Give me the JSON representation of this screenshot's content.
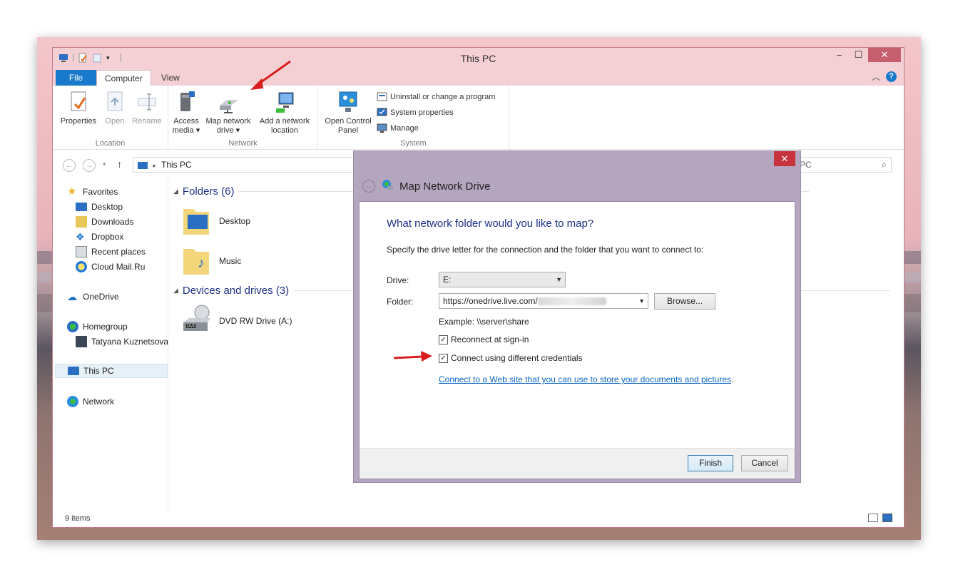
{
  "window": {
    "title": "This PC",
    "tabs": {
      "file": "File",
      "computer": "Computer",
      "view": "View"
    },
    "minimize": "−",
    "maximize": "☐",
    "close": "✕",
    "help": "?"
  },
  "ribbon": {
    "location": {
      "label": "Location",
      "properties": "Properties",
      "open": "Open",
      "rename": "Rename"
    },
    "network": {
      "label": "Network",
      "access_media": [
        "Access",
        "media ▾"
      ],
      "map_drive": [
        "Map network",
        "drive ▾"
      ],
      "add_location": [
        "Add a network",
        "location"
      ]
    },
    "system": {
      "label": "System",
      "open_cp": [
        "Open Control",
        "Panel"
      ],
      "uninstall": "Uninstall or change a program",
      "sysprops": "System properties",
      "manage": "Manage"
    }
  },
  "address": {
    "path": "This PC",
    "search_tail": "PC"
  },
  "nav": {
    "favorites": "Favorites",
    "desktop": "Desktop",
    "downloads": "Downloads",
    "dropbox": "Dropbox",
    "recent": "Recent places",
    "cloudmail": "Cloud Mail.Ru",
    "onedrive": "OneDrive",
    "homegroup": "Homegroup",
    "user": "Tatyana Kuznetsova",
    "thispc": "This PC",
    "network": "Network"
  },
  "content": {
    "folders_header": "Folders (6)",
    "folder_desktop": "Desktop",
    "folder_music": "Music",
    "devices_header": "Devices and drives (3)",
    "dvd": "DVD RW Drive (A:)"
  },
  "status": {
    "items": "9 items"
  },
  "dialog": {
    "title": "Map Network Drive",
    "close": "✕",
    "question": "What network folder would you like to map?",
    "description": "Specify the drive letter for the connection and the folder that you want to connect to:",
    "drive_label": "Drive:",
    "drive_value": "E:",
    "folder_label": "Folder:",
    "folder_value": "https://onedrive.live.com/",
    "browse": "Browse...",
    "example": "Example: \\\\server\\share",
    "reconnect": "Reconnect at sign-in",
    "reconnect_checked": true,
    "credentials": "Connect using different credentials",
    "credentials_checked": true,
    "link": "Connect to a Web site that you can use to store your documents and pictures",
    "link_period": ".",
    "finish": "Finish",
    "cancel": "Cancel"
  },
  "colors": {
    "accent": "#1979ca",
    "titlebar": "#f4cfd4",
    "dialog_frame": "#b5a6bf",
    "heading_blue": "#1e3287",
    "annotation_red": "#d81e1e"
  }
}
